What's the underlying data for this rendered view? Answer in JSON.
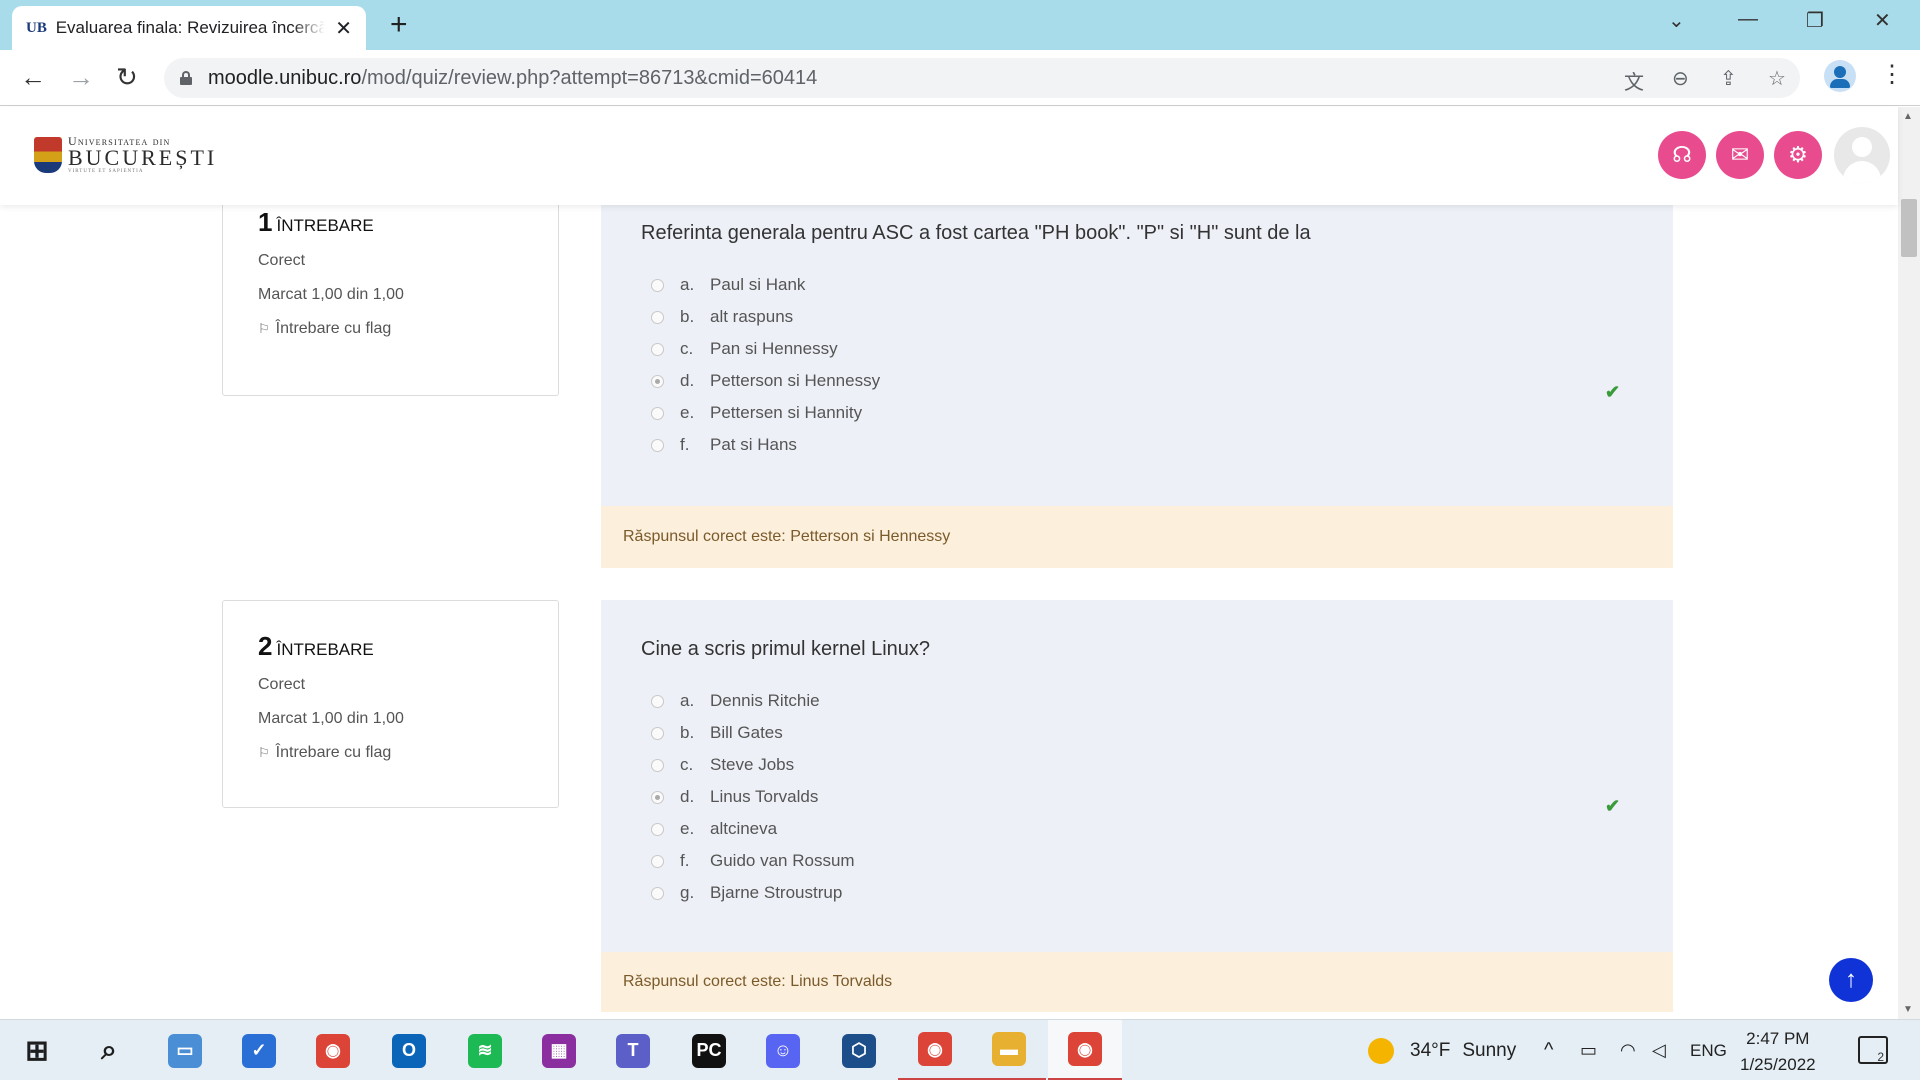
{
  "browser": {
    "tab_favicon": "UB",
    "tab_title": "Evaluarea finala: Revizuirea încercării",
    "url_host": "moodle.unibuc.ro",
    "url_path": "/mod/quiz/review.php?attempt=86713&cmid=60414"
  },
  "header": {
    "logo_line1": "Universitatea din",
    "logo_line2": "BUCUREȘTI",
    "logo_line3": "VIRTUTE ET SAPIENTIA"
  },
  "questions": [
    {
      "number": "1",
      "label": "Întrebare",
      "state": "Corect",
      "grade": "Marcat 1,00 din 1,00",
      "flag_label": "Întrebare cu flag",
      "text": "Referinta generala pentru ASC a fost cartea \"PH book\". \"P\" si \"H\" sunt de la",
      "answers": [
        {
          "letter": "a.",
          "text": "Paul si Hank"
        },
        {
          "letter": "b.",
          "text": "alt raspuns"
        },
        {
          "letter": "c.",
          "text": "Pan si Hennessy"
        },
        {
          "letter": "d.",
          "text": "Petterson si Hennessy"
        },
        {
          "letter": "e.",
          "text": "Pettersen si Hannity"
        },
        {
          "letter": "f.",
          "text": "Pat si Hans"
        }
      ],
      "selected_index": 3,
      "feedback": "Răspunsul corect este: Petterson si Hennessy"
    },
    {
      "number": "2",
      "label": "Întrebare",
      "state": "Corect",
      "grade": "Marcat 1,00 din 1,00",
      "flag_label": "Întrebare cu flag",
      "text": "Cine a scris primul kernel Linux?",
      "answers": [
        {
          "letter": "a.",
          "text": "Dennis Ritchie"
        },
        {
          "letter": "b.",
          "text": "Bill Gates"
        },
        {
          "letter": "c.",
          "text": "Steve Jobs"
        },
        {
          "letter": "d.",
          "text": "Linus Torvalds"
        },
        {
          "letter": "e.",
          "text": "altcineva"
        },
        {
          "letter": "f.",
          "text": "Guido van Rossum"
        },
        {
          "letter": "g.",
          "text": "Bjarne Stroustrup"
        }
      ],
      "selected_index": 3,
      "feedback": "Răspunsul corect este: Linus Torvalds"
    }
  ],
  "taskbar": {
    "weather_temp": "34°F",
    "weather_text": "Sunny",
    "language": "ENG",
    "time": "2:47 PM",
    "date": "1/25/2022",
    "notification_count": "2",
    "apps": [
      {
        "name": "start-button",
        "icon": "windows-icon",
        "color": "#1e1e1e"
      },
      {
        "name": "search-button",
        "icon": "search-icon",
        "color": "#1e1e1e"
      },
      {
        "name": "laptop-app",
        "icon": "laptop-icon",
        "color": "#4a8fd6"
      },
      {
        "name": "todo-app",
        "icon": "checkmark-icon",
        "color": "#2a6fd6"
      },
      {
        "name": "chrome-app",
        "icon": "chrome-icon",
        "color": "#db4437"
      },
      {
        "name": "outlook-app",
        "icon": "outlook-icon",
        "color": "#0a64b8"
      },
      {
        "name": "spotify-app",
        "icon": "spotify-icon",
        "color": "#1db954"
      },
      {
        "name": "winrar-app",
        "icon": "archive-icon",
        "color": "#8b2fa0"
      },
      {
        "name": "teams-app",
        "icon": "teams-icon",
        "color": "#5b5fc7"
      },
      {
        "name": "pycharm-app",
        "icon": "pycharm-icon",
        "color": "#111111"
      },
      {
        "name": "discord-app",
        "icon": "discord-icon",
        "color": "#5865f2"
      },
      {
        "name": "virtualbox-app",
        "icon": "cube-icon",
        "color": "#1c4f8a"
      },
      {
        "name": "chrome-profile-app",
        "icon": "chrome-icon",
        "color": "#db4437"
      },
      {
        "name": "file-explorer-app",
        "icon": "folder-icon",
        "color": "#e8b030"
      },
      {
        "name": "chrome-active-app",
        "icon": "chrome-icon",
        "color": "#db4437"
      }
    ]
  },
  "colors": {
    "accent_pink": "#e84c8f",
    "question_bg": "#edf0f7",
    "feedback_bg": "#fcefdc",
    "correct_green": "#3a9b3a",
    "back_to_top": "#1033d8"
  }
}
